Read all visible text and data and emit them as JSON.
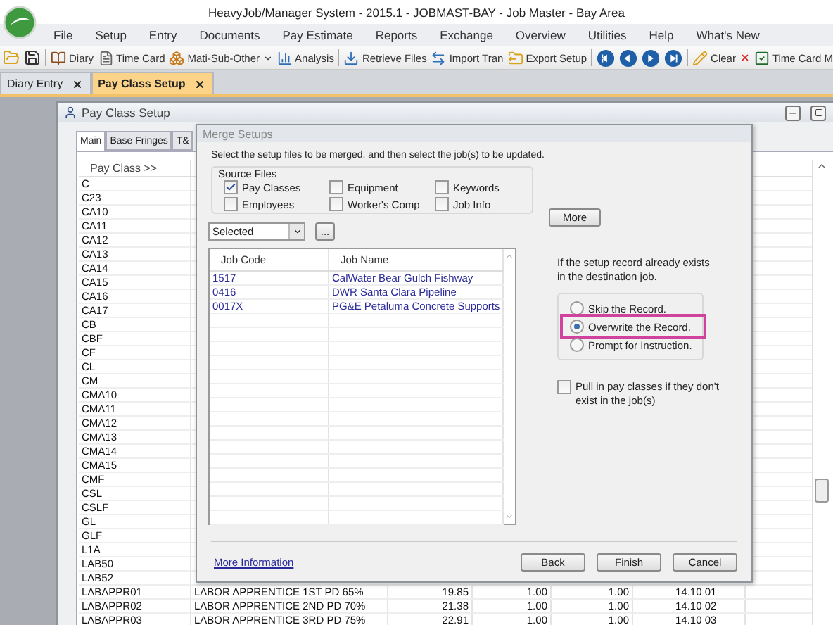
{
  "window": {
    "title": "HeavyJob/Manager System - 2015.1 - JOBMAST-BAY - Job Master - Bay Area"
  },
  "menu": [
    "File",
    "Setup",
    "Entry",
    "Documents",
    "Pay Estimate",
    "Reports",
    "Exchange",
    "Overview",
    "Utilities",
    "Help",
    "What's New"
  ],
  "toolbar": [
    {
      "kind": "icon"
    },
    {
      "kind": "icon"
    },
    {
      "kind": "separator"
    },
    {
      "kind": "labeled",
      "label": "Diary"
    },
    {
      "kind": "labeled",
      "label": "Time Card"
    },
    {
      "kind": "dropdown",
      "label": "Mati-Sub-Other"
    },
    {
      "kind": "labeled",
      "label": "Analysis"
    },
    {
      "kind": "separator"
    },
    {
      "kind": "labeled",
      "label": "Retrieve Files"
    },
    {
      "kind": "labeled",
      "label": "Import Tran"
    },
    {
      "kind": "labeled",
      "label": "Export Setup"
    },
    {
      "kind": "separator"
    },
    {
      "kind": "icon"
    },
    {
      "kind": "icon"
    },
    {
      "kind": "icon"
    },
    {
      "kind": "icon"
    },
    {
      "kind": "separator"
    },
    {
      "kind": "labeled",
      "label": "Clear"
    },
    {
      "kind": "icon"
    },
    {
      "kind": "labeled",
      "label": "Time Card M"
    }
  ],
  "doc_tabs": [
    {
      "label": "Diary Entry",
      "selected": false
    },
    {
      "label": "Pay Class Setup",
      "selected": true
    }
  ],
  "child_window": {
    "title": "Pay Class Setup",
    "tabs": [
      {
        "label": "Main",
        "selected": true
      },
      {
        "label": "Base Fringes",
        "selected": false
      },
      {
        "label": "T&",
        "selected": false
      }
    ],
    "grid": {
      "header": "Pay Class >>",
      "rows": [
        {
          "cells": [
            "C"
          ]
        },
        {
          "cells": [
            "C23"
          ]
        },
        {
          "cells": [
            "CA10"
          ]
        },
        {
          "cells": [
            "CA11"
          ]
        },
        {
          "cells": [
            "CA12"
          ]
        },
        {
          "cells": [
            "CA13"
          ]
        },
        {
          "cells": [
            "CA14"
          ]
        },
        {
          "cells": [
            "CA15"
          ]
        },
        {
          "cells": [
            "CA16"
          ]
        },
        {
          "cells": [
            "CA17"
          ]
        },
        {
          "cells": [
            "CB"
          ]
        },
        {
          "cells": [
            "CBF"
          ]
        },
        {
          "cells": [
            "CF"
          ]
        },
        {
          "cells": [
            "CL"
          ]
        },
        {
          "cells": [
            "CM"
          ]
        },
        {
          "cells": [
            "CMA10"
          ]
        },
        {
          "cells": [
            "CMA11"
          ]
        },
        {
          "cells": [
            "CMA12"
          ]
        },
        {
          "cells": [
            "CMA13"
          ]
        },
        {
          "cells": [
            "CMA14"
          ]
        },
        {
          "cells": [
            "CMA15"
          ]
        },
        {
          "cells": [
            "CMF"
          ]
        },
        {
          "cells": [
            "CSL"
          ]
        },
        {
          "cells": [
            "CSLF"
          ]
        },
        {
          "cells": [
            "GL"
          ]
        },
        {
          "cells": [
            "GLF"
          ]
        },
        {
          "cells": [
            "L1A"
          ]
        },
        {
          "cells": [
            "LAB50"
          ]
        },
        {
          "cells": [
            "LAB52"
          ]
        },
        {
          "cells": [
            "LABAPPR01",
            "LABOR APPRENTICE 1ST PD 65%",
            "19.85",
            "1.00",
            "1.00",
            "14.10 01"
          ]
        },
        {
          "cells": [
            "LABAPPR02",
            "LABOR APPRENTICE 2ND PD 70%",
            "21.38",
            "1.00",
            "1.00",
            "14.10 02"
          ]
        },
        {
          "cells": [
            "LABAPPR03",
            "LABOR APPRENTICE 3RD PD 75%",
            "22.91",
            "1.00",
            "1.00",
            "14.10 03"
          ]
        }
      ]
    }
  },
  "dialog": {
    "title": "Merge Setups",
    "instruction": "Select the setup files to be merged, and then select the job(s) to be updated.",
    "source_files": {
      "label": "Source Files",
      "options": [
        {
          "label": "Pay Classes",
          "checked": true
        },
        {
          "label": "Equipment",
          "checked": false
        },
        {
          "label": "Keywords",
          "checked": false
        },
        {
          "label": "Employees",
          "checked": false
        },
        {
          "label": "Worker's Comp",
          "checked": false
        },
        {
          "label": "Job Info",
          "checked": false
        }
      ]
    },
    "more_button": "More",
    "filter": {
      "value": "Selected"
    },
    "browse_button": "...",
    "jobs": {
      "columns": [
        "Job Code",
        "Job Name"
      ],
      "rows": [
        {
          "code": "1517",
          "name": "CalWater Bear Gulch Fishway"
        },
        {
          "code": "0416",
          "name": "DWR Santa Clara Pipeline"
        },
        {
          "code": "0017X",
          "name": "PG&E Petaluma Concrete Supports"
        }
      ]
    },
    "exists_note": "If the setup record already exists in the destination job.",
    "exists_options": [
      {
        "label": "Skip the Record.",
        "selected": false,
        "highlighted": false
      },
      {
        "label": "Overwrite the Record.",
        "selected": true,
        "highlighted": true
      },
      {
        "label": "Prompt for Instruction.",
        "selected": false,
        "highlighted": false
      }
    ],
    "pull_in": {
      "label": "Pull in pay classes if they don't exist in the job(s)",
      "checked": false
    },
    "link": "More Information",
    "buttons": [
      "Back",
      "Finish",
      "Cancel"
    ]
  }
}
